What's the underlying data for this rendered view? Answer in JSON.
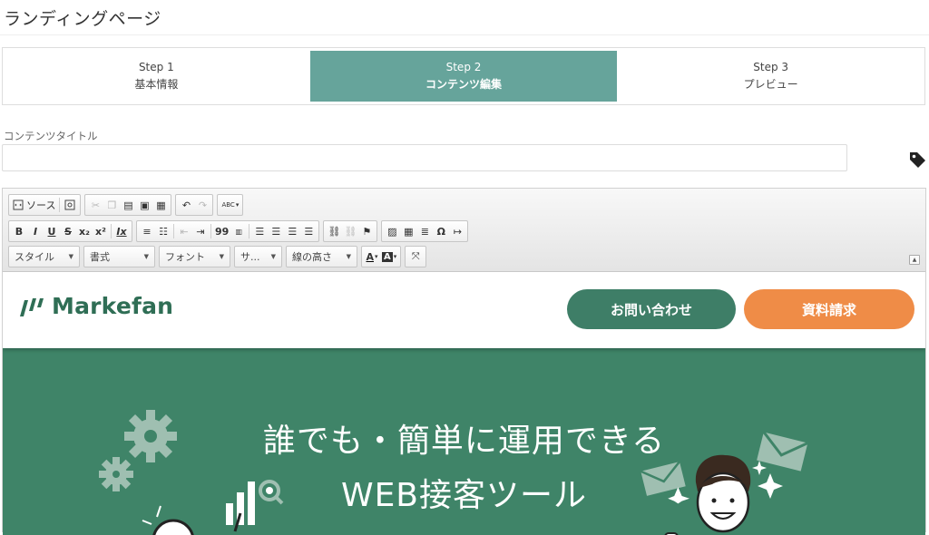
{
  "page": {
    "title": "ランディングページ"
  },
  "stepper": {
    "steps": [
      {
        "num": "Step 1",
        "name": "基本情報",
        "active": false
      },
      {
        "num": "Step 2",
        "name": "コンテンツ編集",
        "active": true
      },
      {
        "num": "Step 3",
        "name": "プレビュー",
        "active": false
      }
    ]
  },
  "form": {
    "title_label": "コンテンツタイトル",
    "title_value": "",
    "tag_icon": "tag-icon"
  },
  "toolbar": {
    "source_label": "ソース",
    "styles_combo": "スタイル",
    "format_combo": "書式",
    "font_combo": "フォント",
    "size_combo": "サ...",
    "lineheight_combo": "線の高さ",
    "bold": "B",
    "italic": "I",
    "underline": "U",
    "strike": "S",
    "subscript": "x₂",
    "superscript": "x²",
    "removeformat": "Ix",
    "quote": "99",
    "omega": "Ω",
    "textcolor": "A",
    "bgcolor": "A",
    "spellcheck": "ABC"
  },
  "content": {
    "brand": "Markefan",
    "contact_button": "お問い合わせ",
    "docs_button": "資料請求",
    "hero_line1": "誰でも・簡単に運用できる",
    "hero_line2": "WEB接客ツール",
    "colors": {
      "brand_green": "#3e7e67",
      "hero_green": "#3f8468",
      "cta_orange": "#ef8c47",
      "step_active": "#66a49b"
    }
  }
}
